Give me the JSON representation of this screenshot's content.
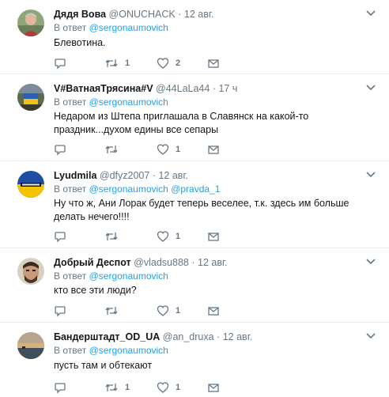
{
  "reply_prefix": "В ответ",
  "tweets": [
    {
      "name": "Дядя Вова",
      "handle": "@ONUCHACK",
      "dot": "·",
      "time": "12 авг.",
      "mentions": "@sergonaumovich",
      "text": "Блевотина.",
      "replies": "",
      "retweets": "1",
      "likes": "2"
    },
    {
      "name": "V#ВатнаяТрясина#V",
      "handle": "@44LaLa44",
      "dot": "·",
      "time": "17 ч",
      "mentions": "@sergonaumovich",
      "text": "Недаром из Штепа приглашала в Славянск на какой-то праздник...духом едины все сепары",
      "replies": "",
      "retweets": "",
      "likes": "1"
    },
    {
      "name": "Lyudmila",
      "handle": "@dfyz2007",
      "dot": "·",
      "time": "12 авг.",
      "mentions": "@sergonaumovich @pravda_1",
      "text": "Ну что ж, Ани Лорак будет теперь веселее, т.к. здесь им больше делать нечего!!!!",
      "replies": "",
      "retweets": "",
      "likes": "1"
    },
    {
      "name": "Добрый Деспот",
      "handle": "@vladsu888",
      "dot": "·",
      "time": "12 авг.",
      "mentions": "@sergonaumovich",
      "text": "кто все эти люди?",
      "replies": "",
      "retweets": "",
      "likes": "1"
    },
    {
      "name": "Бандерштадт_OD_UA",
      "handle": "@an_druxa",
      "dot": "·",
      "time": "12 авг.",
      "mentions": "@sergonaumovich",
      "text": "пусть там и обтекают",
      "replies": "",
      "retweets": "1",
      "likes": "1"
    }
  ],
  "icons": {
    "reply": "reply-icon",
    "retweet": "retweet-icon",
    "like": "heart-icon",
    "dm": "envelope-icon",
    "menu": "chevron-down-icon"
  },
  "colors": {
    "link": "#1da1f2",
    "secondary": "#657786",
    "divider": "#e6ecf0",
    "text": "#14171a"
  }
}
